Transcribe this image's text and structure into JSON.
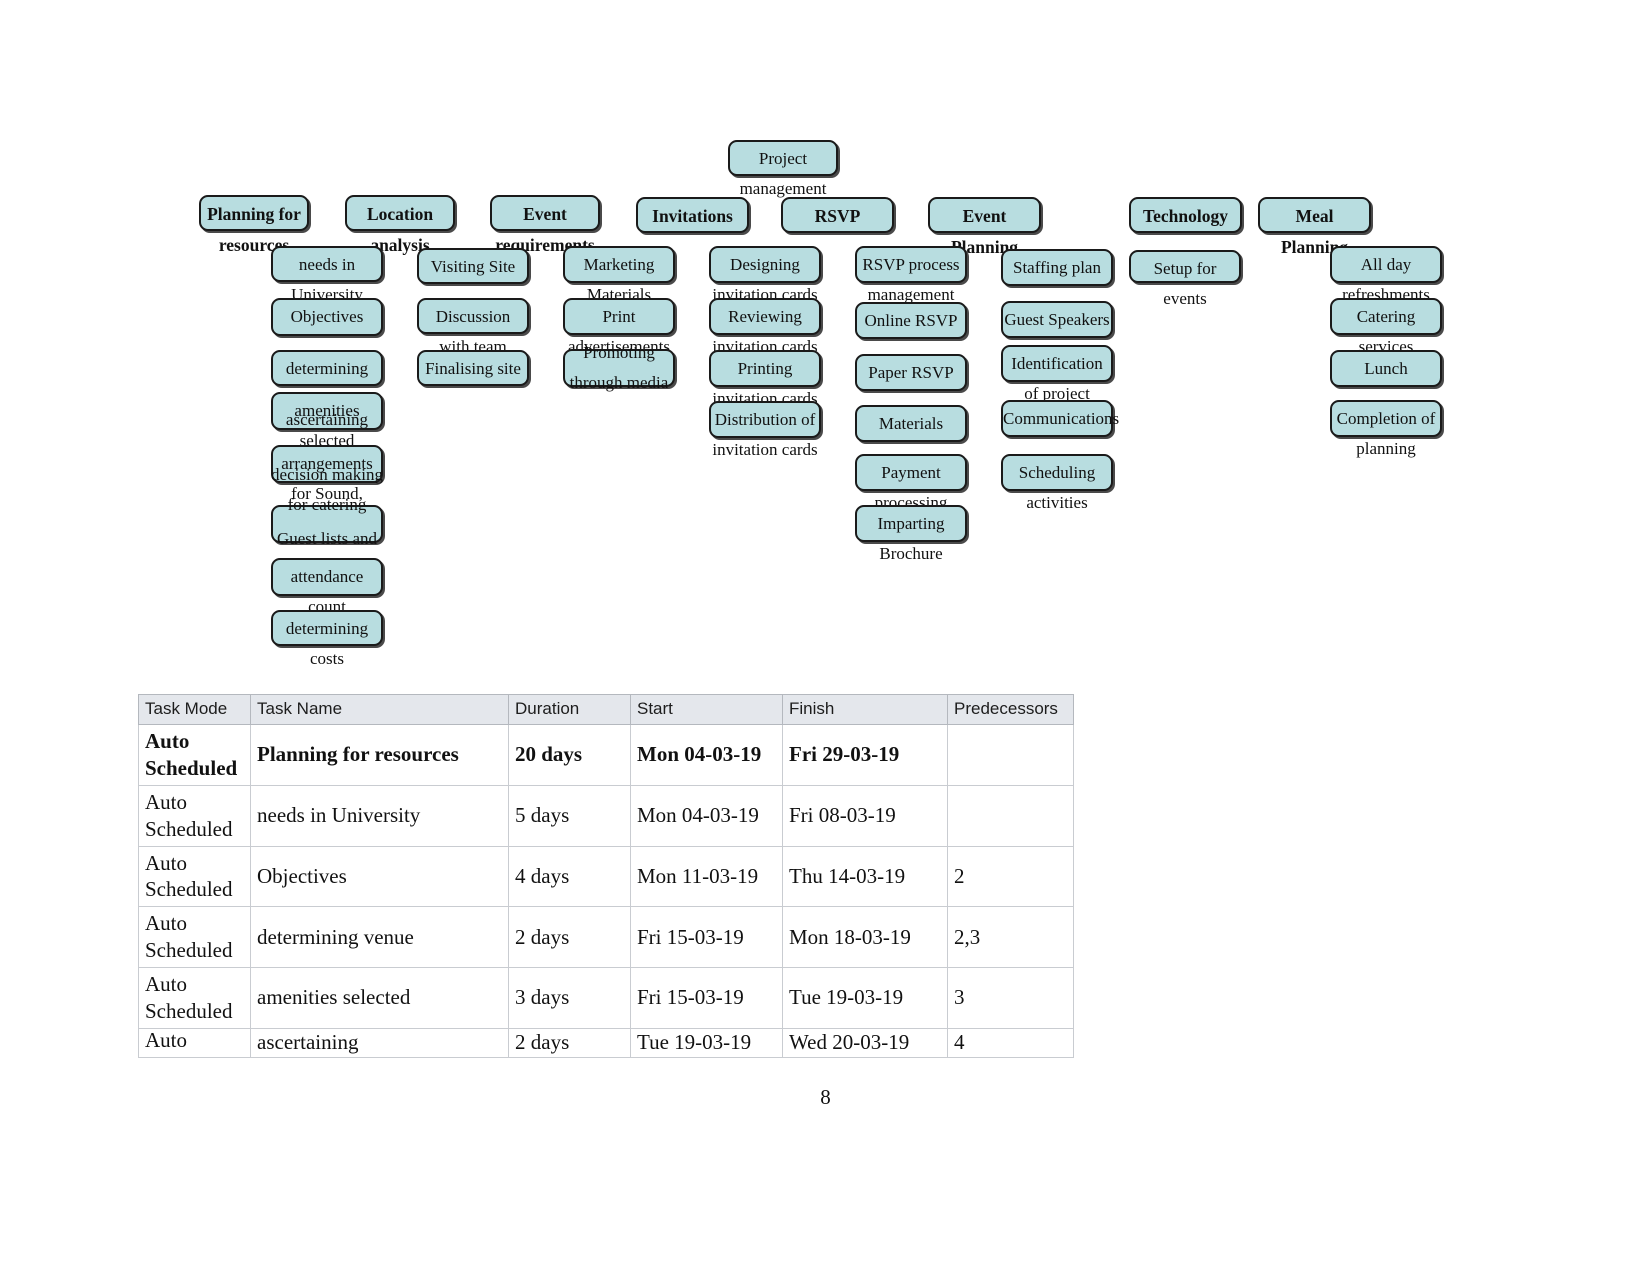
{
  "document": {
    "page_number": "8",
    "colors": {
      "node_fill": "#b8dde0",
      "node_border": "#1a1a1a",
      "table_header_bg": "#e4e7ec",
      "table_border": "#c9ccd1"
    }
  },
  "wbs": {
    "root": {
      "label": "Project management"
    },
    "branches": [
      {
        "label": "Planning for resources",
        "children": [
          "needs in University",
          "Objectives",
          "determining venue",
          "amenities selected",
          "ascertaining",
          "arrangements for Sound, stage",
          "decision making for catering",
          "Guest lists and",
          "attendance count",
          "determining costs"
        ]
      },
      {
        "label": "Location analysis",
        "children": [
          "Visiting Site",
          "Discussion with team",
          "Finalising site"
        ]
      },
      {
        "label": "Event requirements",
        "children": []
      },
      {
        "label": "Invitations",
        "children": [
          "Marketing Materials",
          "Print advertisements",
          "Promoting through media"
        ]
      },
      {
        "label": "RSVP",
        "children": [
          "Designing invitation cards",
          "Reviewing invitation cards",
          "Printing invitation cards",
          "Distribution of invitation cards"
        ]
      },
      {
        "label": "Event Planning",
        "children": [
          "RSVP process management",
          "Online RSVP",
          "Paper RSVP",
          "Materials",
          "Payment processing",
          "Imparting Brochure"
        ]
      },
      {
        "label": "Technology",
        "children": [
          "Staffing plan",
          "Guest Speakers",
          "Identification of project",
          "Communications",
          "Scheduling activities"
        ]
      },
      {
        "label": "Meal Planning",
        "children": [
          "Setup for events",
          "All day refreshments",
          "Catering services",
          "Lunch",
          "Completion of planning"
        ]
      }
    ],
    "nodes": {
      "root": "Project management",
      "l1_planning": "Planning for resources",
      "l1_location": "Location analysis",
      "l1_event_req": "Event requirements",
      "l1_invitations": "Invitations",
      "l1_rsvp": "RSVP",
      "l1_event_planning": "Event Planning",
      "l1_technology": "Technology",
      "l1_meal": "Meal Planning",
      "c_needs": "needs in University",
      "c_objectives": "Objectives",
      "c_venue": "determining venue",
      "c_amenities": "amenities selected",
      "c_ascertaining": "ascertaining",
      "c_arrangements": "arrangements for Sound, stage",
      "c_decision": "decision making for catering",
      "c_guest_lists": "Guest lists and",
      "c_attendance": "attendance count",
      "c_costs": "determining costs",
      "c_visiting": "Visiting Site",
      "c_discussion": "Discussion with team",
      "c_finalising": "Finalising site",
      "c_marketing": "Marketing Materials",
      "c_print_ads": "Print advertisements",
      "c_promoting": "Promoting through media",
      "c_designing": "Designing invitation cards",
      "c_reviewing": "Reviewing invitation cards",
      "c_printing": "Printing invitation cards",
      "c_distribution": "Distribution of invitation cards",
      "c_rsvp_process": "RSVP process management",
      "c_online_rsvp": "Online RSVP",
      "c_paper_rsvp": "Paper RSVP",
      "c_materials": "Materials",
      "c_payment": "Payment processing",
      "c_imparting": "Imparting Brochure",
      "c_staffing": "Staffing plan",
      "c_speakers": "Guest Speakers",
      "c_identification": "Identification of project",
      "c_communications": "Communications",
      "c_scheduling": "Scheduling activities",
      "c_setup": "Setup for events",
      "c_allday": "All day refreshments",
      "c_catering_svc": "Catering services",
      "c_lunch": "Lunch",
      "c_completion": "Completion of planning"
    }
  },
  "task_table": {
    "columns": [
      "Task Mode",
      "Task Name",
      "Duration",
      "Start",
      "Finish",
      "Predecessors"
    ],
    "rows": [
      {
        "mode": "Auto Scheduled",
        "name": "Planning for resources",
        "duration": "20 days",
        "start": "Mon 04-03-19",
        "finish": "Fri 29-03-19",
        "predecessors": ""
      },
      {
        "mode": "Auto Scheduled",
        "name": "needs in University",
        "duration": "5 days",
        "start": "Mon 04-03-19",
        "finish": "Fri 08-03-19",
        "predecessors": ""
      },
      {
        "mode": "Auto Scheduled",
        "name": "Objectives",
        "duration": "4 days",
        "start": "Mon 11-03-19",
        "finish": "Thu 14-03-19",
        "predecessors": "2"
      },
      {
        "mode": "Auto Scheduled",
        "name": "determining venue",
        "duration": "2 days",
        "start": "Fri 15-03-19",
        "finish": "Mon 18-03-19",
        "predecessors": "2,3"
      },
      {
        "mode": "Auto Scheduled",
        "name": "amenities selected",
        "duration": "3 days",
        "start": "Fri 15-03-19",
        "finish": "Tue 19-03-19",
        "predecessors": "3"
      },
      {
        "mode": "Auto",
        "name": "ascertaining",
        "duration": "2 days",
        "start": "Tue 19-03-19",
        "finish": "Wed 20-03-19",
        "predecessors": "4"
      }
    ]
  }
}
